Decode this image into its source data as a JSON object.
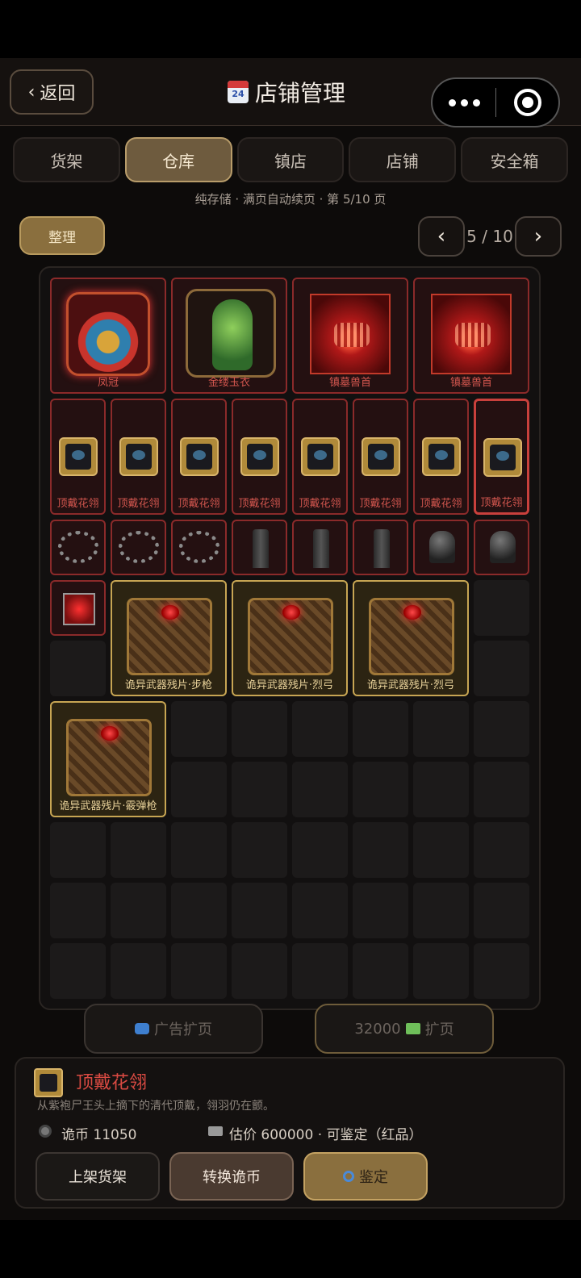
{
  "header": {
    "back_label": "返回",
    "title": "店铺管理",
    "calendar_icon_text": "24"
  },
  "tabs": [
    {
      "label": "货架",
      "active": false
    },
    {
      "label": "仓库",
      "active": true
    },
    {
      "label": "镇店",
      "active": false
    },
    {
      "label": "店铺",
      "active": false
    },
    {
      "label": "安全箱",
      "active": false
    }
  ],
  "subinfo": "纯存储 · 满页自动续页 · 第 5/10 页",
  "toolbar": {
    "sort_label": "整理",
    "prev_label": "‹",
    "page_text": "5 / 10",
    "next_label": "›"
  },
  "items": {
    "crown": "凤冠",
    "armor": "金缕玉衣",
    "beast1": "镇墓兽首",
    "beast2": "镇墓兽首",
    "hat": "顶戴花翎",
    "chest_spear": "诡异武器残片·步枪",
    "chest_bow1": "诡异武器残片·烈弓",
    "chest_bow2": "诡异武器残片·烈弓",
    "chest_shotgun": "诡异武器残片·霰弹枪"
  },
  "expand": {
    "ad_label": "广告扩页",
    "pay_amount": "32000",
    "pay_label": "扩页"
  },
  "detail": {
    "name": "顶戴花翎",
    "desc": "从紫袍尸王头上摘下的清代顶戴，翎羽仍在颤。",
    "coin": "诡币 11050",
    "price": "估价 600000 · 可鉴定（红品）",
    "btn_shelve": "上架货架",
    "btn_convert": "转换诡币",
    "btn_identify": "鉴定"
  }
}
